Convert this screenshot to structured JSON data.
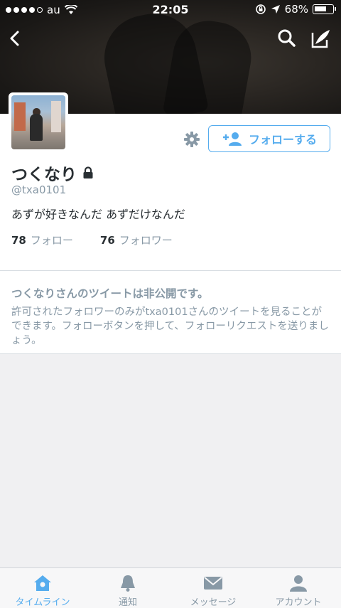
{
  "status_bar": {
    "carrier": "au",
    "time": "22:05",
    "battery": "68%",
    "battery_level": 0.68
  },
  "profile": {
    "name": "つくなり",
    "handle": "@txa0101",
    "bio": "あずが好きなんだ あずだけなんだ",
    "follow_button": "フォローする",
    "stats": [
      {
        "count": "78",
        "label": "フォロー"
      },
      {
        "count": "76",
        "label": "フォロワー"
      }
    ]
  },
  "private_notice": {
    "title": "つくなりさんのツイートは非公開です。",
    "body": "許可されたフォロワーのみがtxa0101さんのツイートを見ることができます。フォローボタンを押して、フォローリクエストを送りましょう。"
  },
  "tabbar": {
    "tabs": [
      {
        "label": "タイムライン",
        "icon": "home-icon",
        "active": true
      },
      {
        "label": "通知",
        "icon": "bell-icon",
        "active": false
      },
      {
        "label": "メッセージ",
        "icon": "envelope-icon",
        "active": false
      },
      {
        "label": "アカウント",
        "icon": "person-icon",
        "active": false
      }
    ]
  },
  "colors": {
    "accent": "#55acee",
    "muted": "#8899a6",
    "text": "#292f33"
  }
}
